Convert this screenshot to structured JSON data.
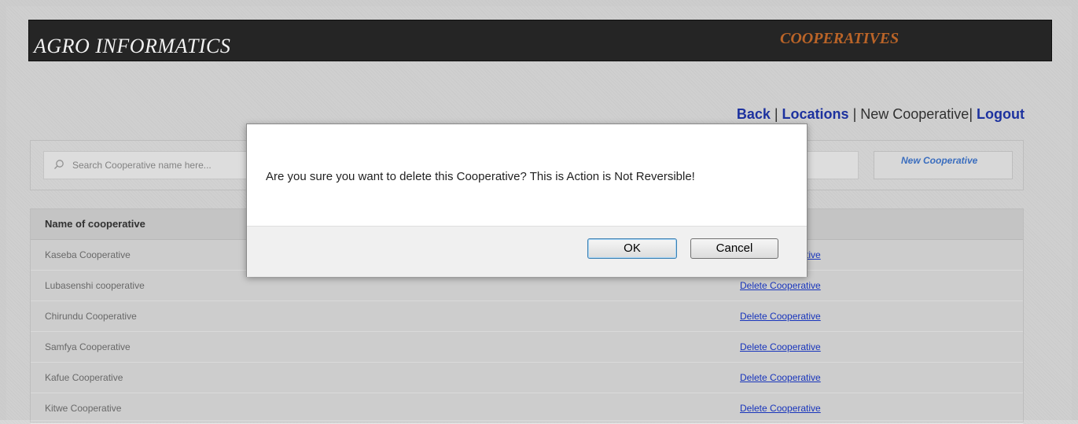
{
  "header": {
    "app_title": "AGRO INFORMATICS",
    "section_title": "COOPERATIVES"
  },
  "topnav": {
    "back": "Back",
    "sep1": " | ",
    "locations": "Locations",
    "sep2": " | ",
    "new_cooperative": "New Cooperative",
    "sep3": "| ",
    "logout": "Logout"
  },
  "search": {
    "placeholder": "Search Cooperative name here...",
    "new_button": "New Cooperative"
  },
  "table": {
    "header": "Name of cooperative",
    "rows": [
      {
        "name": "Kaseba Cooperative",
        "action": "Delete Cooperative"
      },
      {
        "name": "Lubasenshi cooperative",
        "action": "Delete Cooperative"
      },
      {
        "name": "Chirundu Cooperative",
        "action": "Delete Cooperative"
      },
      {
        "name": "Samfya Cooperative",
        "action": "Delete Cooperative"
      },
      {
        "name": "Kafue Cooperative",
        "action": "Delete Cooperative"
      },
      {
        "name": "Kitwe Cooperative",
        "action": "Delete Cooperative"
      }
    ]
  },
  "dialog": {
    "message": "Are you sure you want to delete this Cooperative? This is Action is Not Reversible!",
    "ok": "OK",
    "cancel": "Cancel"
  },
  "colors": {
    "header_bg": "#272727",
    "section_title": "#c56a2b",
    "link": "#1a38c7",
    "nav_link": "#1f35a8"
  }
}
